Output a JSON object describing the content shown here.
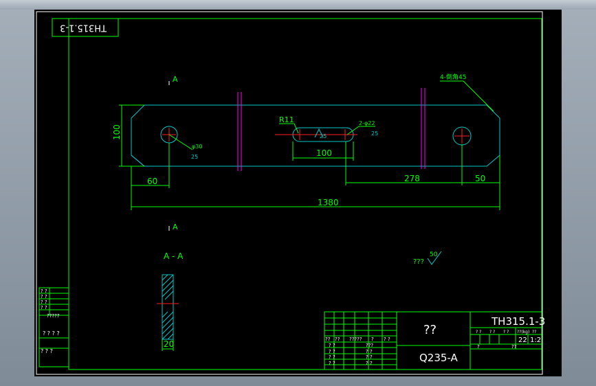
{
  "drawing": {
    "code_stamp": "TH315.1-3",
    "section_mark_top": "A",
    "section_mark_bottom": "A",
    "section_view_label": "A - A",
    "roughness_note": "???",
    "roughness_value": "50",
    "part_name": "??",
    "part_code": "TH315.1-3",
    "material": "Q235-A",
    "quantity": "22",
    "scale": "1:2"
  },
  "dimensions": {
    "overall_length": "1380",
    "left_hole_offset": "60",
    "height": "100",
    "slot_spacing": "100",
    "right_span": "278",
    "right_hole_offset": "50",
    "slot_radius": "R11",
    "slot_note": "2-φ22",
    "left_hole_dia": "φ30",
    "chamfer_note": "4-倒角45",
    "roughness_a": "25",
    "roughness_b": "25",
    "roughness_c": "25",
    "thickness": "20"
  },
  "revision_block": [
    "? ?",
    "? ?",
    "? ?",
    "? ?",
    "?????",
    "? ? ? ?",
    "? ? ?"
  ],
  "title_block": {
    "row1": [
      "??",
      "??",
      "?????",
      "?",
      "? ?"
    ],
    "row2": [
      "? ?",
      "???"
    ],
    "row3": [
      "? ?",
      "? ?"
    ],
    "row4": [
      "? ?",
      "? ?"
    ],
    "row5": [
      "? ?",
      "? ?"
    ],
    "right_small": [
      "? ?",
      "? ?",
      "? ?",
      "??(kg)",
      "??"
    ],
    "bottom_small": [
      "?",
      "??"
    ]
  }
}
